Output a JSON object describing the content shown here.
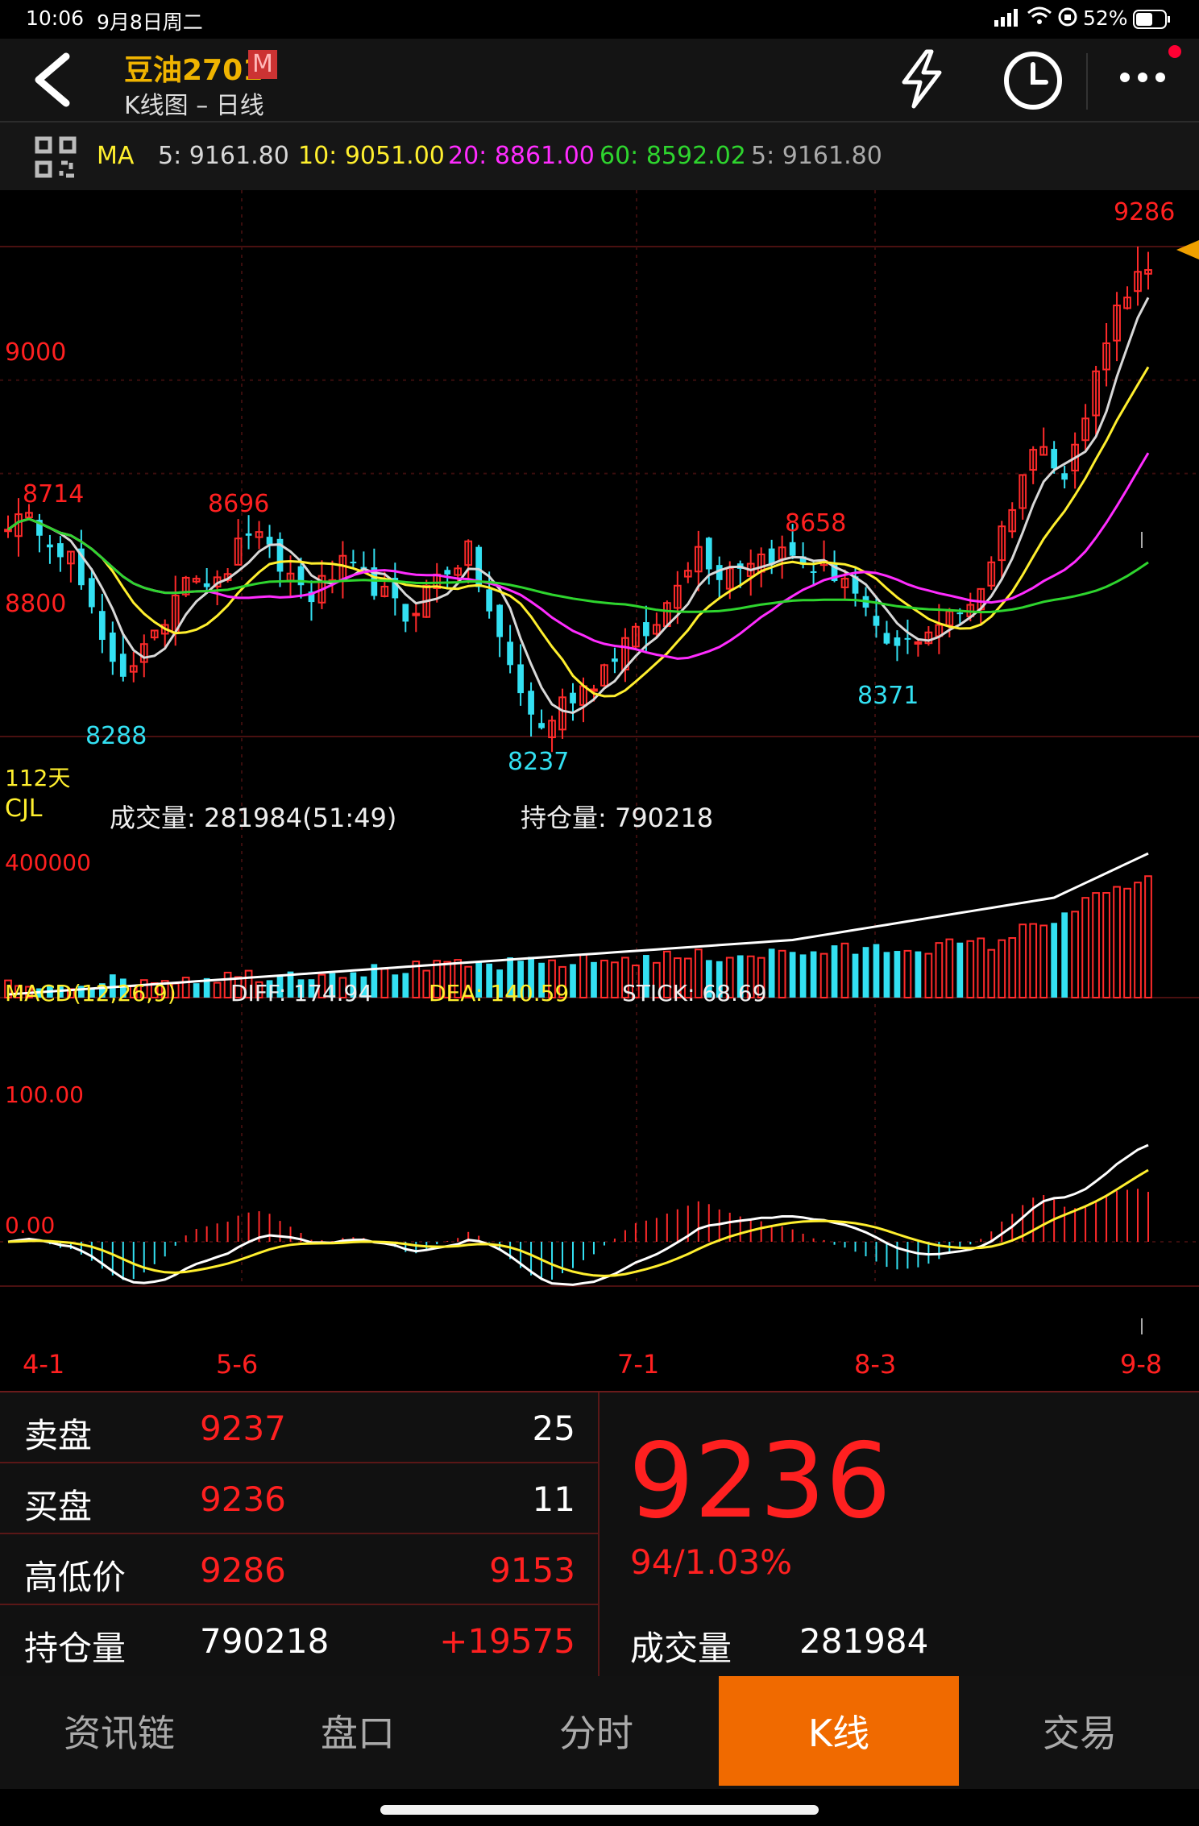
{
  "status_bar": {
    "time": "10:06",
    "date": "9月8日周二",
    "battery": "52%"
  },
  "header": {
    "title": "豆油2701",
    "badge": "M",
    "subtitle": "K线图 – 日线",
    "icons": [
      "back-icon",
      "flash-icon",
      "clock-icon",
      "more-icon"
    ]
  },
  "ma_bar": {
    "label": "MA",
    "ma5": "5: 9161.80",
    "ma10": "10: 9051.00",
    "ma20": "20: 8861.00",
    "ma60": "60: 8592.02",
    "ma5_repeat": "5: 9161.80",
    "colors": {
      "ma5": "#d8d8d8",
      "ma10": "#ffef2e",
      "ma20": "#ff2cff",
      "ma60": "#2ed52e"
    }
  },
  "main_chart": {
    "y_labels": [
      {
        "text": "9000",
        "price": 9000
      },
      {
        "text": "8800",
        "price": 8800
      }
    ],
    "high_labels": [
      {
        "text": "8714",
        "idx": 4
      },
      {
        "text": "8696",
        "idx": 23
      },
      {
        "text": "8658",
        "idx": 78
      },
      {
        "text": "9286",
        "idx": 108
      }
    ],
    "low_labels": [
      {
        "text": "8288",
        "idx": 10
      },
      {
        "text": "8237",
        "idx": 50
      },
      {
        "text": "8371",
        "idx": 85
      }
    ],
    "period": "112天"
  },
  "volume_panel": {
    "label": "CJL",
    "volume": "成交量: 281984(51:49)",
    "open_interest": "持仓量: 790218",
    "y_label": "400000"
  },
  "macd_panel": {
    "label": "MACD(12,26,9)",
    "diff": "DIFF: 174.94",
    "dea": "DEA: 140.59",
    "stick": "STICK: 68.69",
    "y_labels": [
      "100.00",
      "0.00"
    ]
  },
  "x_labels": [
    "4-1",
    "5-6",
    "7-1",
    "8-3",
    "9-8"
  ],
  "chart_data": {
    "type": "candlestick",
    "x_labels": [
      "4-1",
      "5-6",
      "7-1",
      "8-3",
      "9-8"
    ],
    "key_prices": {
      "high": 9286,
      "low": 8237,
      "last": 9236
    },
    "close_keypoints": [
      [
        0,
        8700
      ],
      [
        3,
        8690
      ],
      [
        6,
        8620
      ],
      [
        9,
        8430
      ],
      [
        11,
        8380
      ],
      [
        14,
        8440
      ],
      [
        17,
        8600
      ],
      [
        20,
        8560
      ],
      [
        23,
        8680
      ],
      [
        26,
        8600
      ],
      [
        29,
        8540
      ],
      [
        32,
        8600
      ],
      [
        35,
        8560
      ],
      [
        38,
        8490
      ],
      [
        41,
        8580
      ],
      [
        44,
        8630
      ],
      [
        47,
        8440
      ],
      [
        49,
        8330
      ],
      [
        51,
        8250
      ],
      [
        53,
        8310
      ],
      [
        56,
        8360
      ],
      [
        59,
        8440
      ],
      [
        62,
        8470
      ],
      [
        64,
        8580
      ],
      [
        66,
        8640
      ],
      [
        68,
        8590
      ],
      [
        71,
        8620
      ],
      [
        74,
        8630
      ],
      [
        77,
        8600
      ],
      [
        80,
        8580
      ],
      [
        83,
        8450
      ],
      [
        85,
        8420
      ],
      [
        88,
        8470
      ],
      [
        91,
        8500
      ],
      [
        93,
        8560
      ],
      [
        95,
        8680
      ],
      [
        97,
        8800
      ],
      [
        99,
        8880
      ],
      [
        101,
        8790
      ],
      [
        103,
        8920
      ],
      [
        105,
        9100
      ],
      [
        107,
        9200
      ],
      [
        109,
        9236
      ]
    ],
    "ma_lines": {
      "MA5": {
        "last": 9161.8
      },
      "MA10": {
        "last": 9051.0
      },
      "MA20": {
        "last": 8861.0
      },
      "MA60": {
        "last": 8592.02
      }
    },
    "volume_last": 281984,
    "open_interest_last": 790218,
    "macd_last": {
      "DIFF": 174.94,
      "DEA": 140.59,
      "STICK": 68.69
    }
  },
  "quote": {
    "rows": [
      {
        "label": "卖盘",
        "price": "9237",
        "qty": "25"
      },
      {
        "label": "买盘",
        "price": "9236",
        "qty": "11"
      },
      {
        "label": "高低价",
        "price": "9286",
        "qty": "9153"
      },
      {
        "label": "持仓量",
        "price": "790218",
        "qty": "+19575"
      }
    ],
    "last_price": "9236",
    "change": "94/1.03%",
    "volume_label": "成交量",
    "volume_value": "281984"
  },
  "tabs": [
    {
      "label": "资讯链",
      "active": false
    },
    {
      "label": "盘口",
      "active": false
    },
    {
      "label": "分时",
      "active": false
    },
    {
      "label": "K线",
      "active": true
    },
    {
      "label": "交易",
      "active": false
    }
  ]
}
